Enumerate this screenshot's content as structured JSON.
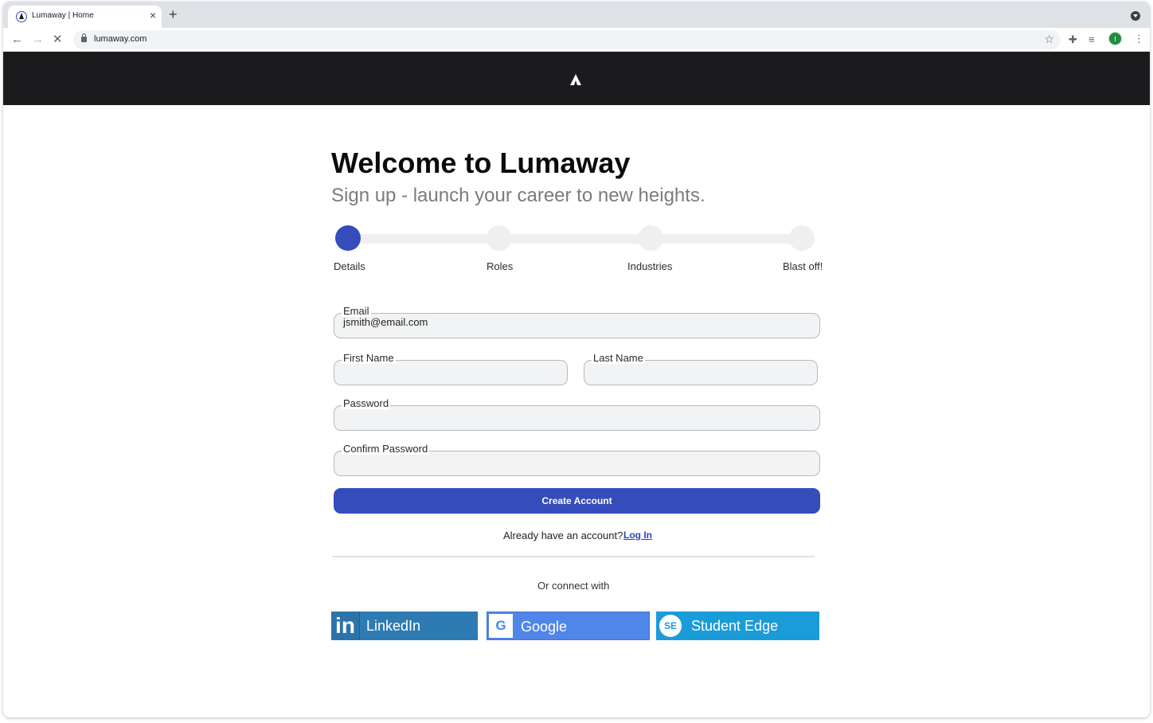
{
  "browser": {
    "tab_title": "Lumaway | Home",
    "tab_close": "×",
    "new_tab": "+",
    "url": "lumaway.com",
    "profile_initial": "I"
  },
  "page": {
    "title": "Welcome to Lumaway",
    "subtitle": "Sign up - launch your career to new heights."
  },
  "steps": [
    {
      "label": "Details",
      "active": true
    },
    {
      "label": "Roles",
      "active": false
    },
    {
      "label": "Industries",
      "active": false
    },
    {
      "label": "Blast off!",
      "active": false
    }
  ],
  "form": {
    "email": {
      "label": "Email",
      "value": "jsmith@email.com"
    },
    "first_name": {
      "label": "First Name",
      "value": ""
    },
    "last_name": {
      "label": "Last Name",
      "value": ""
    },
    "password": {
      "label": "Password",
      "value": ""
    },
    "confirm_password": {
      "label": "Confirm Password",
      "value": ""
    },
    "submit_label": "Create Account"
  },
  "login_prompt": {
    "text": "Already have an account?",
    "link": "Log In"
  },
  "social": {
    "heading": "Or connect with",
    "linkedin": "LinkedIn",
    "google": "Google",
    "student_edge": "Student Edge"
  },
  "colors": {
    "brand": "#354cbb",
    "header_bg": "#1b1b1d",
    "linkedin": "#2d7bb2",
    "google": "#4f86e8",
    "student_edge": "#1a9cd8"
  }
}
